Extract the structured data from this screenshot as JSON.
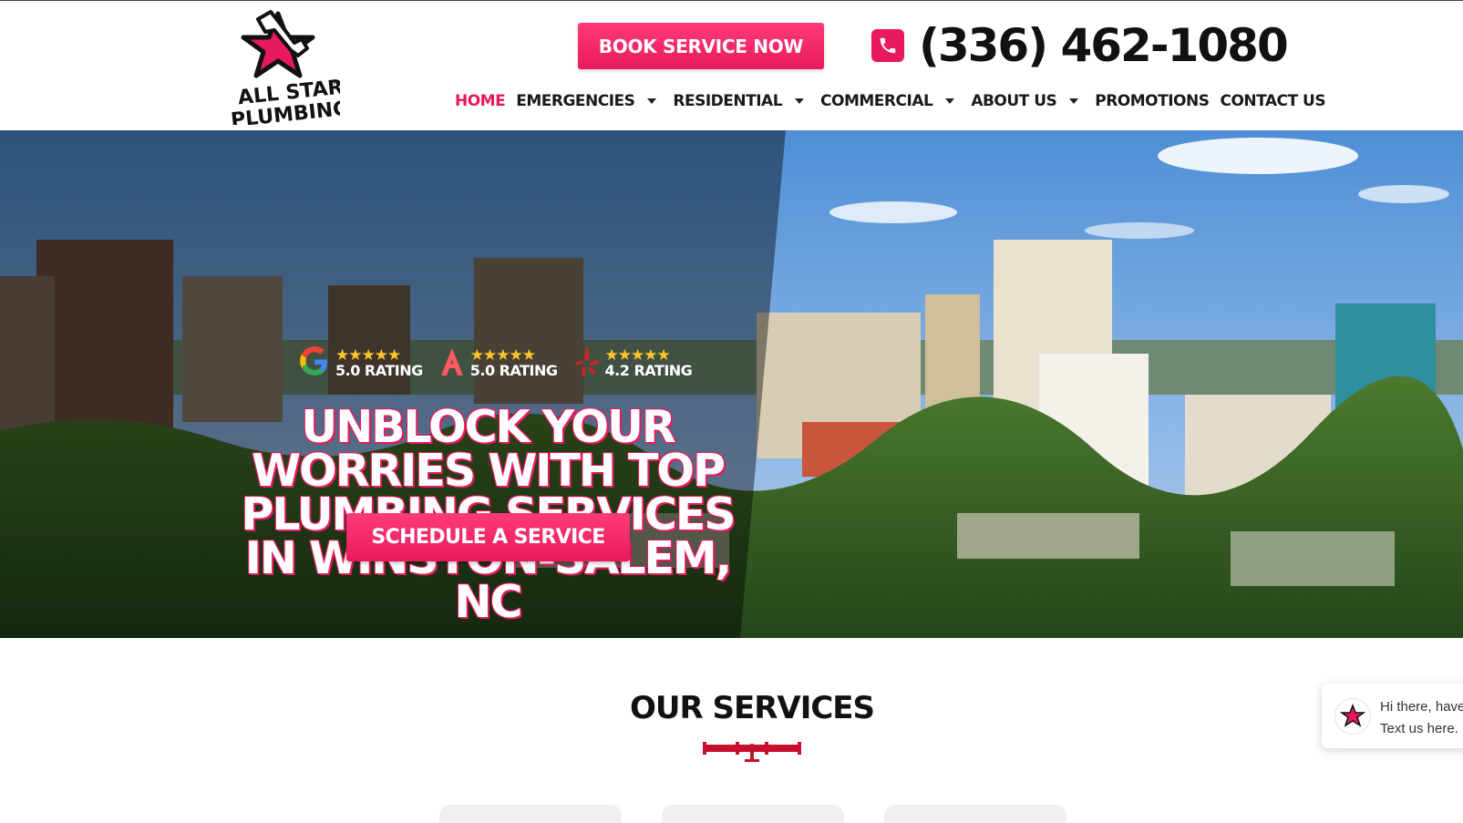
{
  "header": {
    "logo_alt": "All Star Plumbing",
    "book_button": "BOOK SERVICE NOW",
    "phone": "(336) 462-1080"
  },
  "nav": {
    "items": [
      {
        "label": "HOME",
        "active": true,
        "dropdown": false
      },
      {
        "label": "EMERGENCIES",
        "active": false,
        "dropdown": true
      },
      {
        "label": "RESIDENTIAL",
        "active": false,
        "dropdown": true
      },
      {
        "label": "COMMERCIAL",
        "active": false,
        "dropdown": true
      },
      {
        "label": "ABOUT US",
        "active": false,
        "dropdown": true
      },
      {
        "label": "PROMOTIONS",
        "active": false,
        "dropdown": false
      },
      {
        "label": "CONTACT US",
        "active": false,
        "dropdown": false
      }
    ]
  },
  "hero": {
    "ratings": [
      {
        "source_icon": "google-icon",
        "stars": "★★★★★",
        "text": "5.0 RATING"
      },
      {
        "source_icon": "angi-icon",
        "stars": "★★★★★",
        "text": "5.0 RATING"
      },
      {
        "source_icon": "yelp-icon",
        "stars": "★★★★★",
        "text": "4.2 RATING"
      }
    ],
    "headline_lines": [
      "UNBLOCK YOUR",
      "WORRIES WITH TOP",
      "PLUMBING SERVICES",
      "IN WINSTON-SALEM,",
      "NC"
    ],
    "schedule_button": "SCHEDULE A SERVICE"
  },
  "services": {
    "title": "OUR SERVICES"
  },
  "chat": {
    "line1": "Hi there, have",
    "line2": "Text us here."
  },
  "colors": {
    "accent": "#e8195c",
    "star": "#ffc726",
    "text": "#111111"
  }
}
